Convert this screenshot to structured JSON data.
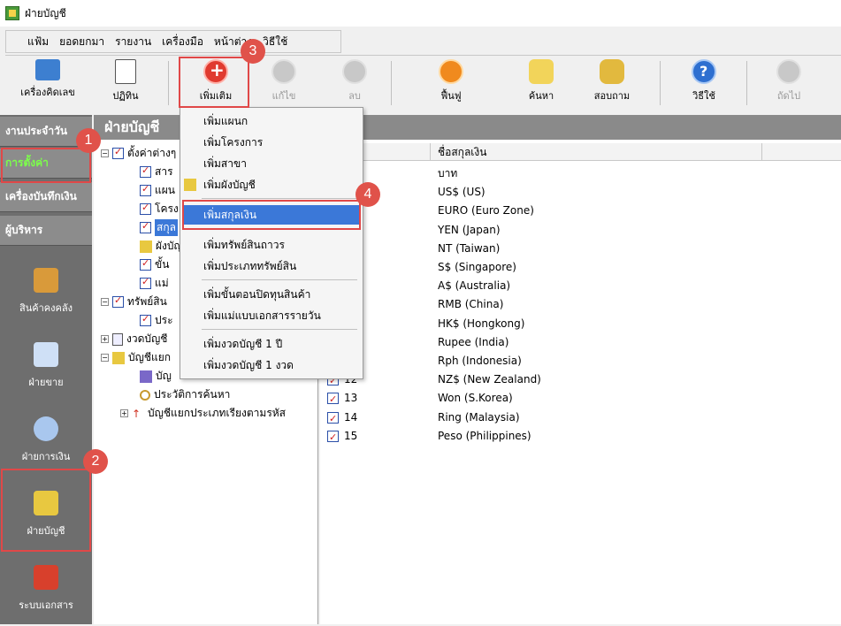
{
  "window": {
    "title": "ฝ่ายบัญชี"
  },
  "menu": [
    {
      "label": "แฟ้ม"
    },
    {
      "label": "ยอดยกมา"
    },
    {
      "label": "รายงาน"
    },
    {
      "label": "เครื่องมือ"
    },
    {
      "label": "หน้าต่าง"
    },
    {
      "label": "วิธีใช้"
    }
  ],
  "toolbar": {
    "calculator": "เครื่องคิดเลข",
    "calendar": "ปฏิทิน",
    "add": "เพิ่มเติม",
    "edit": "แก้ไข",
    "delete": "ลบ",
    "refresh": "ฟื้นฟู",
    "search": "ค้นหา",
    "inquiry": "สอบถาม",
    "help": "วิธีใช้",
    "next": "ถัดไป"
  },
  "leftnav": {
    "daily": "งานประจำวัน",
    "settings": "การตั้งค่า",
    "cheque": "เครื่องบันทึกเงิน",
    "admin": "ผู้บริหาร",
    "inventory": "สินค้าคงคลัง",
    "sales": "ฝ่ายขาย",
    "finance": "ฝ่ายการเงิน",
    "accounting": "ฝ่ายบัญชี",
    "documents": "ระบบเอกสาร"
  },
  "panel": {
    "title": "ฝ่ายบัญชี"
  },
  "tree": {
    "root": "ตั้งค่าต่างๆ",
    "n1": "สาร",
    "n2": "แผน",
    "n3": "โครง",
    "n4": "สกุล",
    "n5": "ผังบัญชี",
    "n6": "ขั้น",
    "n7": "แม่",
    "asset": "ทรัพย์สิน",
    "asset_child": "ประ",
    "period": "งวดบัญชี",
    "ledger": "บัญชีแยก",
    "ledger_c1": "บัญ",
    "ledger_c2": "ประวัติการค้นหา",
    "ledger_c3": "บัญชีแยกประเภทเรียงตามรหัส"
  },
  "grid": {
    "column_name": "ชื่อสกุลเงิน",
    "rows": [
      {
        "code": "",
        "name": "บาท"
      },
      {
        "code": "",
        "name": "US$ (US)"
      },
      {
        "code": "",
        "name": "EURO (Euro Zone)"
      },
      {
        "code": "",
        "name": "YEN (Japan)"
      },
      {
        "code": "",
        "name": "NT (Taiwan)"
      },
      {
        "code": "",
        "name": "S$ (Singapore)"
      },
      {
        "code": "",
        "name": "A$ (Australia)"
      },
      {
        "code": "",
        "name": "RMB (China)"
      },
      {
        "code": "",
        "name": "HK$ (Hongkong)"
      },
      {
        "code": "",
        "name": "Rupee (India)"
      },
      {
        "code": "",
        "name": "Rph (Indonesia)"
      },
      {
        "code": "12",
        "name": "NZ$ (New Zealand)"
      },
      {
        "code": "13",
        "name": "Won (S.Korea)"
      },
      {
        "code": "14",
        "name": "Ring (Malaysia)"
      },
      {
        "code": "15",
        "name": "Peso (Philippines)"
      }
    ]
  },
  "dropdown": {
    "items": [
      "เพิ่มแผนก",
      "เพิ่มโครงการ",
      "เพิ่มสาขา",
      "เพิ่มผังบัญชี",
      "เพิ่มสกุลเงิน",
      "เพิ่มทรัพย์สินถาวร",
      "เพิ่มประเภททรัพย์สิน",
      "เพิ่มขั้นตอนปิดทุนสินค้า",
      "เพิ่มแม่แบบเอกสารรายวัน",
      "เพิ่มงวดบัญชี 1 ปี",
      "เพิ่มงวดบัญชี 1 งวด"
    ],
    "selected": "เพิ่มสกุลเงิน"
  },
  "badges": [
    "1",
    "2",
    "3",
    "4"
  ],
  "colors": {
    "highlight": "#e04848",
    "badge": "#e0524a",
    "selection": "#3b78d8",
    "nav_active_text": "#7cff4a"
  }
}
